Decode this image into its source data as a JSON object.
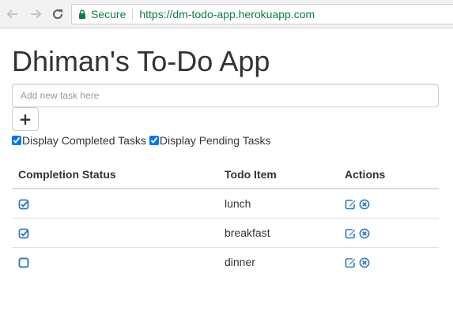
{
  "browser": {
    "secure_label": "Secure",
    "url": "https://dm-todo-app.herokuapp.com",
    "icons": [
      "back-icon",
      "forward-icon",
      "reload-icon",
      "lock-icon"
    ]
  },
  "app": {
    "title": "Dhiman's To-Do App",
    "task_placeholder": "Add new task here",
    "task_value": "",
    "add_label": "+",
    "filters": {
      "completed_label": "Display Completed Tasks",
      "completed_checked": true,
      "pending_label": "Display Pending Tasks",
      "pending_checked": true
    }
  },
  "table": {
    "headers": {
      "status": "Completion Status",
      "item": "Todo Item",
      "actions": "Actions"
    },
    "rows": [
      {
        "completed": true,
        "item": "lunch"
      },
      {
        "completed": true,
        "item": "breakfast"
      },
      {
        "completed": false,
        "item": "dinner"
      }
    ]
  },
  "colors": {
    "accent": "#337ab7",
    "secure_green": "#0b8043",
    "border": "#dddddd"
  },
  "icons": {
    "status_done": "checked-square-icon",
    "status_pending": "empty-square-icon",
    "edit": "edit-icon",
    "delete": "delete-circle-icon"
  }
}
